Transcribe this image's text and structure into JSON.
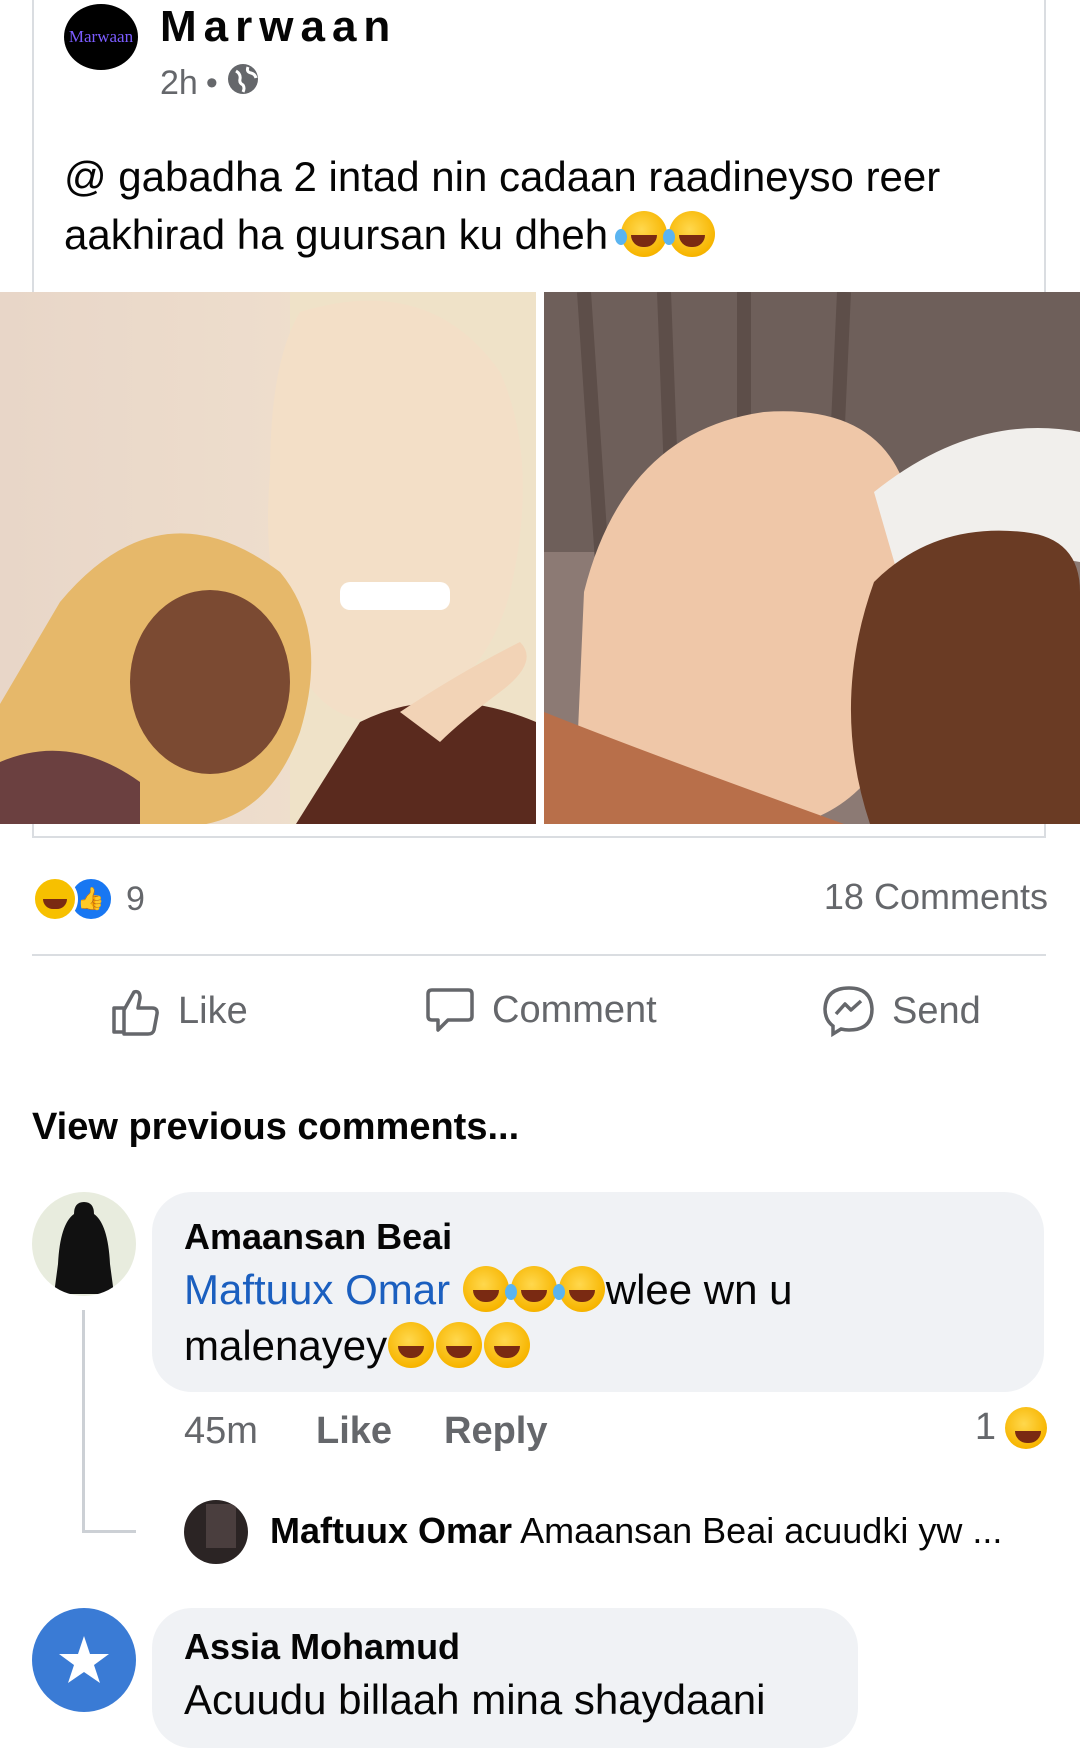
{
  "post": {
    "author": "Marwaan",
    "avatar_text": "Marwaan",
    "time": "2h",
    "separator": "•",
    "privacy_icon": "globe-icon",
    "text_line1": "@ gabadha 2 intad nin cadaan raadineyso reer",
    "text_line2": "aakhirad ha guursan ku dheh"
  },
  "stats": {
    "reaction_count": "9",
    "comments": "18 Comments"
  },
  "actions": {
    "like": "Like",
    "comment": "Comment",
    "send": "Send"
  },
  "comments_section": {
    "view_previous": "View previous comments..."
  },
  "comment1": {
    "name": "Amaansan Beai",
    "mention": "Maftuux Omar",
    "text_after": "wlee wn u",
    "text_line2": "malenayey",
    "time": "45m",
    "like": "Like",
    "reply": "Reply",
    "reaction_count": "1"
  },
  "reply1": {
    "name": "Maftuux Omar",
    "text": "Amaansan Beai acuudki yw ..."
  },
  "comment2": {
    "name": "Assia Mohamud",
    "text": "Acuudu billaah mina shaydaani"
  },
  "colors": {
    "accent": "#1877f2",
    "mention": "#1b5fbf",
    "bubble": "#f0f2f5",
    "muted": "#65676b"
  }
}
